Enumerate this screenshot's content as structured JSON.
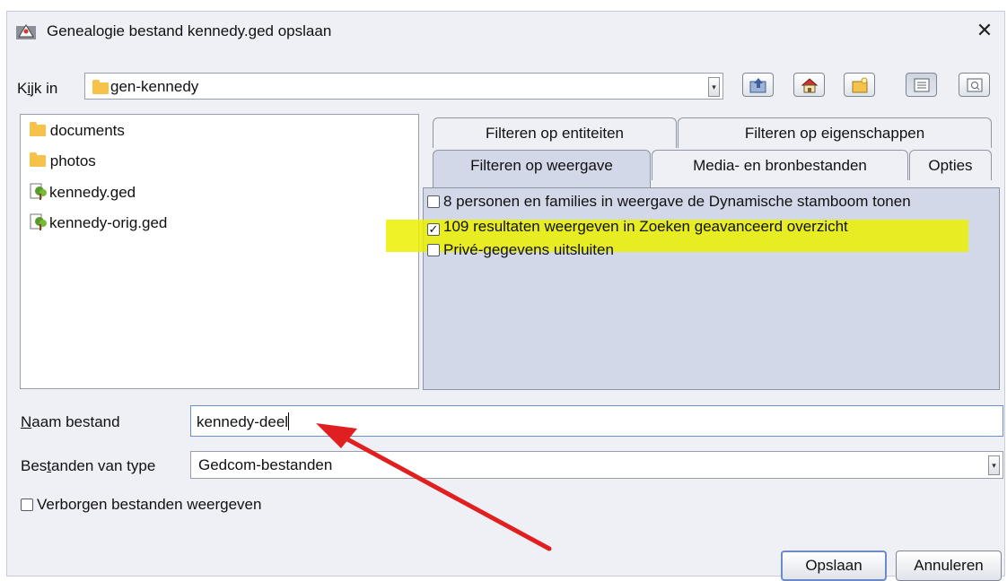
{
  "dialog": {
    "title": "Genealogie bestand kennedy.ged opslaan",
    "close_glyph": "✕",
    "app_icon": "app-icon"
  },
  "lookin": {
    "label_prefix": "K",
    "label_mnemonic": "i",
    "label_suffix": "jk in",
    "value": "gen-kennedy",
    "arrow": "▾"
  },
  "toolbar": {
    "buttons": [
      "up-folder-icon",
      "home-icon",
      "new-folder-icon",
      "list-view-icon",
      "details-view-icon"
    ]
  },
  "files": [
    {
      "name": "documents",
      "type": "folder"
    },
    {
      "name": "photos",
      "type": "folder"
    },
    {
      "name": "kennedy.ged",
      "type": "gedcom"
    },
    {
      "name": "kennedy-orig.ged",
      "type": "gedcom"
    }
  ],
  "tabs": {
    "row1": [
      "Filteren op entiteiten",
      "Filteren op eigenschappen"
    ],
    "row2": [
      "Filteren op weergave",
      "Media- en bronbestanden",
      "Opties"
    ],
    "selected": "Filteren op weergave"
  },
  "options": [
    {
      "label": "8 personen en families in weergave de Dynamische stamboom tonen",
      "checked": false
    },
    {
      "label": "109 resultaten weergeven in Zoeken geavanceerd  overzicht",
      "checked": true
    },
    {
      "label": "Privé-gegevens uitsluiten",
      "checked": false
    }
  ],
  "filename": {
    "label_mnemonic": "N",
    "label_suffix": "aam bestand",
    "value": "kennedy-deel"
  },
  "filetype": {
    "label_prefix": "Bes",
    "label_mnemonic": "t",
    "label_suffix": "anden van type",
    "value": "Gedcom-bestanden",
    "arrow": "▾"
  },
  "hidden_files": {
    "label": "Verborgen bestanden weergeven",
    "checked": false
  },
  "buttons": {
    "save": "Opslaan",
    "cancel": "Annuleren"
  },
  "colors": {
    "highlight": "#ebf000",
    "annotation_arrow": "#e02020",
    "folder": "#f6c24a",
    "selected_tab": "#d2d8e8"
  }
}
